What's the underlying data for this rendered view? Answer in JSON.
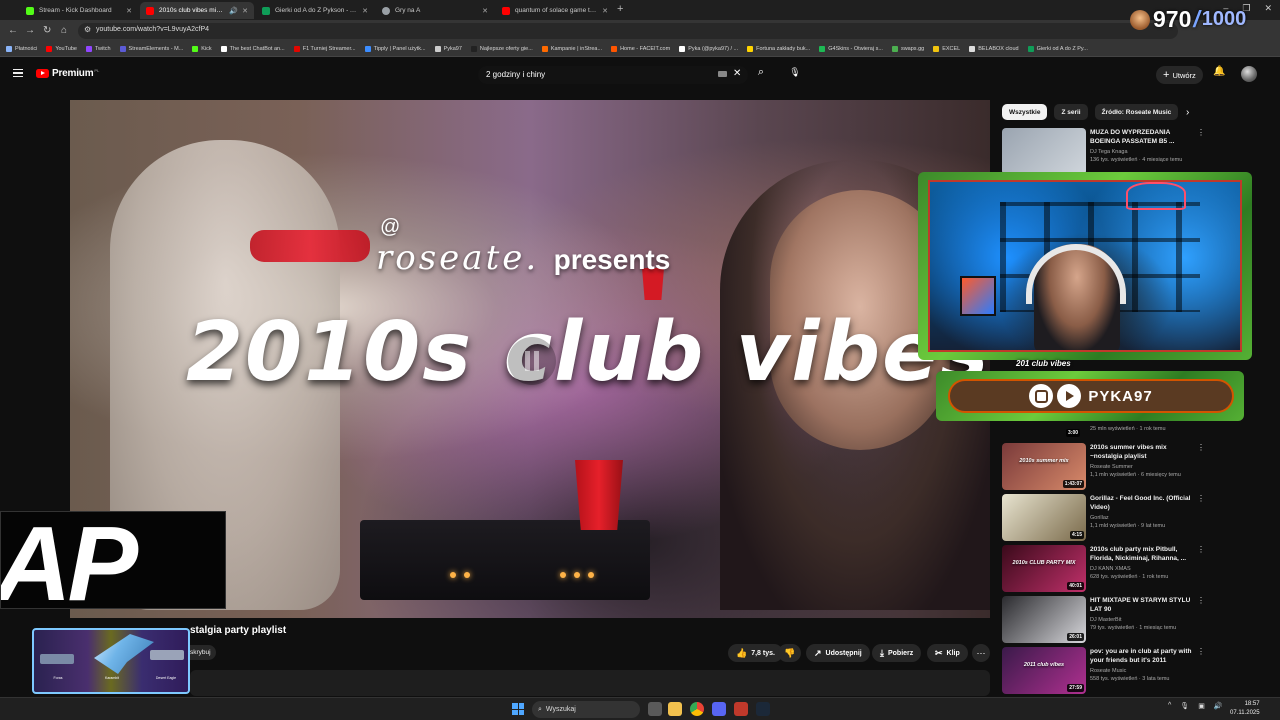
{
  "browser": {
    "tabs": [
      {
        "label": "Stream - Kick Dashboard",
        "color": "#53fc18",
        "active": false
      },
      {
        "label": "2010s club vibes mix ~nostalgia party playlist",
        "color": "#ff0000",
        "active": true
      },
      {
        "label": "Gierki od A do Z Pykson - Arkusz",
        "color": "#0f9d58",
        "active": false
      },
      {
        "label": "Gry na A",
        "color": "#9aa0a6",
        "active": false
      },
      {
        "label": "quantum of solace game trailer",
        "color": "#ff0000",
        "active": false
      }
    ],
    "url": "youtube.com/watch?v=L9vuyA2cfP4",
    "bookmarks": [
      {
        "label": "Płatności",
        "color": "#8ab4f8"
      },
      {
        "label": "YouTube",
        "color": "#ff0000"
      },
      {
        "label": "Twitch",
        "color": "#9146ff"
      },
      {
        "label": "StreamElements - M...",
        "color": "#5b5bd6"
      },
      {
        "label": "Kick",
        "color": "#53fc18"
      },
      {
        "label": "The best ChatBot an...",
        "color": "#ffffff"
      },
      {
        "label": "F1 Turniej Streamer...",
        "color": "#e10600"
      },
      {
        "label": "Tipply | Panel użytk...",
        "color": "#3c8dff"
      },
      {
        "label": "Pyka97",
        "color": "#cccccc"
      },
      {
        "label": "Najlepsze oferty gie...",
        "color": "#222222"
      },
      {
        "label": "Kampanie | inStrea...",
        "color": "#ff6a00"
      },
      {
        "label": "Home - FACEIT.com",
        "color": "#ff5500"
      },
      {
        "label": "Pyka (@pyka97) / ...",
        "color": "#ffffff"
      },
      {
        "label": "Fortuna zakłady buk...",
        "color": "#ffd400"
      },
      {
        "label": "G4Skins - Otwieraj s...",
        "color": "#1db954"
      },
      {
        "label": "swaps.gg",
        "color": "#4caf50"
      },
      {
        "label": "EXCEL",
        "color": "#f1c40f"
      },
      {
        "label": "BELABOX cloud",
        "color": "#dddddd"
      },
      {
        "label": "Gierki od A do Z Py...",
        "color": "#0f9d58"
      }
    ]
  },
  "youtube": {
    "logo_text": "Premium",
    "logo_region": "PL",
    "search_query": "2 godziny i chiny",
    "create_label": "Utwórz"
  },
  "overlay": {
    "counter_current": "970",
    "counter_separator": "/",
    "counter_max": "1000",
    "ap_text": "AP",
    "socials_handle": "PYKA97",
    "mascot_label": "201 club vibes",
    "weapon_slots": [
      "Foras",
      "Karambit",
      "Desert Eagle"
    ]
  },
  "video": {
    "brand": "roseate.",
    "presents": "presents",
    "art_title": "2010s club vibes",
    "title_visible": "stalgia party playlist",
    "subscribe_label": "skrybuj",
    "likes": "7,8 tys.",
    "share_label": "Udostępnij",
    "download_label": "Pobierz",
    "clip_label": "Klip"
  },
  "related": {
    "chips": [
      "Wszystkie",
      "Z serii",
      "Źródło: Roseate Music"
    ],
    "items": [
      {
        "title": "MUZA DO WYPRZEDANIA BOEINGA PASSATEM B5 ...",
        "channel": "DJ Tega Knaga",
        "meta": "136 tys. wyświetleń · 4 miesiące temu",
        "duration": "",
        "thumb_colors": [
          "#9aa4b0",
          "#d0d6dc"
        ],
        "thumb_text": ""
      },
      {
        "title": "",
        "channel": "",
        "meta": "25 mln wyświetleń · 1 rok temu",
        "duration": "3:00",
        "thumb_colors": [
          "#2a1e2a",
          "#6a4a5a"
        ],
        "thumb_text": ""
      },
      {
        "title": "2010s summer vibes mix ~nostalgia playlist",
        "channel": "Roseate Summer",
        "meta": "1,1 mln wyświetleń · 6 miesięcy temu",
        "duration": "1:43:07",
        "thumb_colors": [
          "#7a3a3a",
          "#d88a6a"
        ],
        "thumb_text": "2010s summer mix"
      },
      {
        "title": "Gorillaz - Feel Good Inc. (Official Video)",
        "channel": "Gorillaz",
        "meta": "1,1 mld wyświetleń · 9 lat temu",
        "duration": "4:15",
        "thumb_colors": [
          "#e8e4d0",
          "#7a6a4a"
        ],
        "thumb_text": ""
      },
      {
        "title": "2010s club party mix Pitbull, Florida, Nickiminaj, Rihanna, ...",
        "channel": "DJ KANN XMAS",
        "meta": "628 tys. wyświetleń · 1 rok temu",
        "duration": "40:01",
        "thumb_colors": [
          "#3a0a1a",
          "#c0306a"
        ],
        "thumb_text": "2010s CLUB PARTY MIX"
      },
      {
        "title": "HIT MIXTAPE W STARYM STYLU LAT 90",
        "channel": "DJ MasterBit",
        "meta": "79 tys. wyświetleń · 1 miesiąc temu",
        "duration": "26:01",
        "thumb_colors": [
          "#2a2a2e",
          "#d8d8dc"
        ],
        "thumb_text": ""
      },
      {
        "title": "pov: you are in club at party with your friends but it's 2011",
        "channel": "Roseate Music",
        "meta": "558 tys. wyświetleń · 3 lata temu",
        "duration": "27:59",
        "thumb_colors": [
          "#3a1a4a",
          "#b03090"
        ],
        "thumb_text": "2011 club vibes"
      }
    ]
  },
  "taskbar": {
    "search_label": "Wyszukaj",
    "time": "18:57",
    "date": "07.11.2025"
  }
}
